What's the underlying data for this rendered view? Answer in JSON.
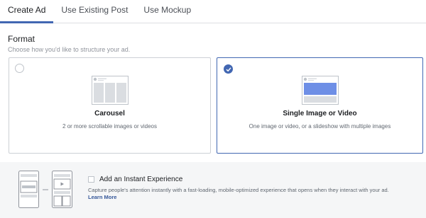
{
  "tabs": [
    {
      "label": "Create Ad",
      "active": true
    },
    {
      "label": "Use Existing Post",
      "active": false
    },
    {
      "label": "Use Mockup",
      "active": false
    }
  ],
  "format": {
    "title": "Format",
    "subtitle": "Choose how you'd like to structure your ad.",
    "options": [
      {
        "id": "carousel",
        "title": "Carousel",
        "description": "2 or more scrollable images or videos",
        "selected": false,
        "icon": "carousel-preview-icon"
      },
      {
        "id": "single",
        "title": "Single Image or Video",
        "description": "One image or video, or a slideshow with multiple images",
        "selected": true,
        "icon": "single-image-preview-icon"
      }
    ]
  },
  "instant_experience": {
    "title": "Add an Instant Experience",
    "description": "Capture people's attention instantly with a fast-loading, mobile-optimized experience that opens when they interact with your ad.",
    "link": "Learn More",
    "checked": false,
    "icon": "instant-experience-preview-icon"
  },
  "colors": {
    "accent": "#4267b2",
    "border": "#ccd0d5",
    "band_bg": "#f5f6f7",
    "link": "#365899"
  }
}
